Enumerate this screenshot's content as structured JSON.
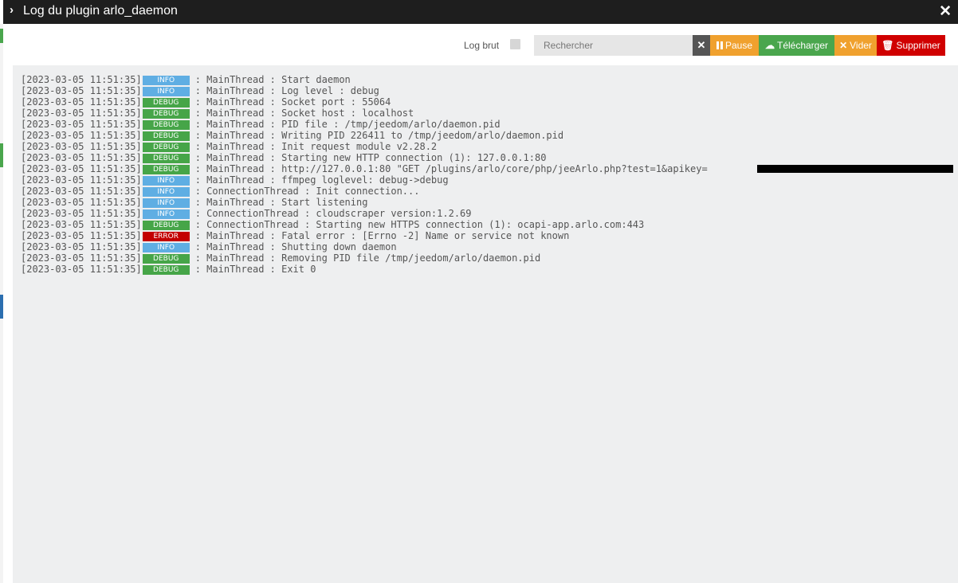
{
  "window": {
    "title": "Log du plugin arlo_daemon"
  },
  "toolbar": {
    "log_brut_label": "Log brut",
    "search_placeholder": "Rechercher",
    "pause_label": "Pause",
    "download_label": "Télécharger",
    "clear_label": "Vider",
    "delete_label": "Supprimer"
  },
  "icons": {
    "title": "chevron-right-icon",
    "close": "close-icon",
    "clear_search": "times-icon",
    "pause": "pause-icon",
    "download": "cloud-download-icon",
    "empty": "times-icon",
    "delete": "trash-icon"
  },
  "colors": {
    "info": "#5faee3",
    "debug": "#46a548",
    "error": "#c30000",
    "pause": "#f0a12e",
    "download": "#4aa64d",
    "delete": "#d00000"
  },
  "log": [
    {
      "ts": "[2023-03-05 11:51:35]",
      "level": "INFO",
      "msg": ": MainThread : Start daemon"
    },
    {
      "ts": "[2023-03-05 11:51:35]",
      "level": "INFO",
      "msg": ": MainThread : Log level : debug"
    },
    {
      "ts": "[2023-03-05 11:51:35]",
      "level": "DEBUG",
      "msg": ": MainThread : Socket port : 55064"
    },
    {
      "ts": "[2023-03-05 11:51:35]",
      "level": "DEBUG",
      "msg": ": MainThread : Socket host : localhost"
    },
    {
      "ts": "[2023-03-05 11:51:35]",
      "level": "DEBUG",
      "msg": ": MainThread : PID file : /tmp/jeedom/arlo/daemon.pid"
    },
    {
      "ts": "[2023-03-05 11:51:35]",
      "level": "DEBUG",
      "msg": ": MainThread : Writing PID 226411 to /tmp/jeedom/arlo/daemon.pid"
    },
    {
      "ts": "[2023-03-05 11:51:35]",
      "level": "DEBUG",
      "msg": ": MainThread : Init request module v2.28.2"
    },
    {
      "ts": "[2023-03-05 11:51:35]",
      "level": "DEBUG",
      "msg": ": MainThread : Starting new HTTP connection (1): 127.0.0.1:80"
    },
    {
      "ts": "[2023-03-05 11:51:35]",
      "level": "DEBUG",
      "msg": ": MainThread : http://127.0.0.1:80 \"GET /plugins/arlo/core/php/jeeArlo.php?test=1&apikey="
    },
    {
      "ts": "[2023-03-05 11:51:35]",
      "level": "INFO",
      "msg": ": MainThread : ffmpeg loglevel: debug->debug"
    },
    {
      "ts": "[2023-03-05 11:51:35]",
      "level": "INFO",
      "msg": ": ConnectionThread : Init connection..."
    },
    {
      "ts": "[2023-03-05 11:51:35]",
      "level": "INFO",
      "msg": ": MainThread : Start listening"
    },
    {
      "ts": "[2023-03-05 11:51:35]",
      "level": "INFO",
      "msg": ": ConnectionThread : cloudscraper version:1.2.69"
    },
    {
      "ts": "[2023-03-05 11:51:35]",
      "level": "DEBUG",
      "msg": ": ConnectionThread : Starting new HTTPS connection (1): ocapi-app.arlo.com:443"
    },
    {
      "ts": "[2023-03-05 11:51:35]",
      "level": "ERROR",
      "msg": ": MainThread : Fatal error : [Errno -2] Name or service not known"
    },
    {
      "ts": "[2023-03-05 11:51:35]",
      "level": "INFO",
      "msg": ": MainThread : Shutting down daemon"
    },
    {
      "ts": "[2023-03-05 11:51:35]",
      "level": "DEBUG",
      "msg": ": MainThread : Removing PID file /tmp/jeedom/arlo/daemon.pid"
    },
    {
      "ts": "[2023-03-05 11:51:35]",
      "level": "DEBUG",
      "msg": ": MainThread : Exit 0"
    }
  ]
}
